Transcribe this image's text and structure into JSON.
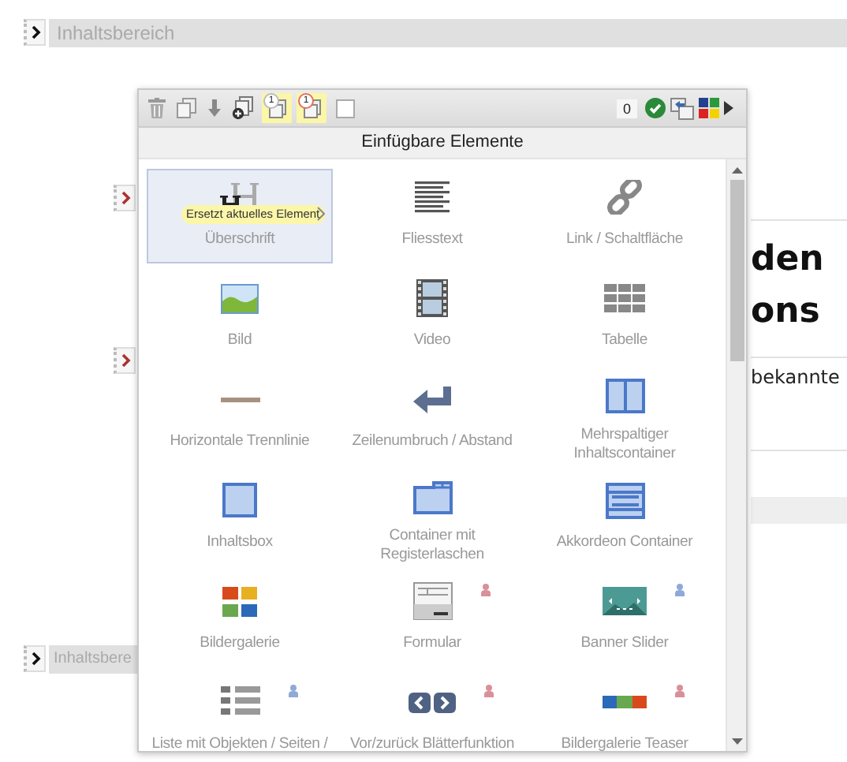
{
  "top_section": {
    "label": "Inhaltsbereich"
  },
  "page_content": {
    "heading_lines": [
      "den",
      "ons"
    ],
    "paragraph": "bekannte"
  },
  "bottom_section": {
    "label": "Inhaltsbere"
  },
  "popup": {
    "toolbar": {
      "buttons": [
        {
          "highlighted": false
        },
        {
          "highlighted": false
        },
        {
          "highlighted": false
        },
        {
          "highlighted": false
        },
        {
          "highlighted": true,
          "badge": "1"
        },
        {
          "highlighted": true,
          "badge": "1"
        }
      ],
      "checkbox": {
        "checked": false
      },
      "counter": "0"
    },
    "title": "Einfügbare Elemente",
    "items": [
      {
        "label": "Überschrift",
        "selected": true,
        "tooltip": "Ersetzt aktuelles Element"
      },
      {
        "label": "Fliesstext",
        "selected": false
      },
      {
        "label": "Link / Schaltfläche",
        "selected": false
      },
      {
        "label": "Bild",
        "selected": false
      },
      {
        "label": "Video",
        "selected": false
      },
      {
        "label": "Tabelle",
        "selected": false
      },
      {
        "label": "Horizontale Trennlinie",
        "selected": false
      },
      {
        "label": "Zeilenumbruch / Abstand",
        "selected": false
      },
      {
        "label": "Mehrspaltiger Inhaltscontainer",
        "selected": false
      },
      {
        "label": "Inhaltsbox",
        "selected": false
      },
      {
        "label": "Container mit Registerlaschen",
        "selected": false
      },
      {
        "label": "Akkordeon Container",
        "selected": false
      },
      {
        "label": "Bildergalerie",
        "selected": false
      },
      {
        "label": "Formular",
        "selected": false,
        "user_badge": {
          "color": "#d9909a"
        }
      },
      {
        "label": "Banner Slider",
        "selected": false,
        "user_badge": {
          "color": "#8fa9d9"
        }
      },
      {
        "label": "Liste mit Objekten / Seiten /",
        "selected": false,
        "user_badge": {
          "color": "#8fa9d9"
        }
      },
      {
        "label": "Vor/zurück Blätterfunktion",
        "selected": false,
        "user_badge": {
          "color": "#d9909a"
        }
      },
      {
        "label": "Bildergalerie Teaser",
        "selected": false,
        "user_badge": {
          "color": "#d9909a"
        }
      }
    ]
  }
}
